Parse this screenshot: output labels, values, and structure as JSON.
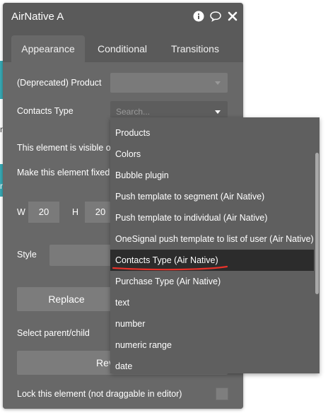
{
  "background": {
    "peek_chars": [
      "n",
      "r"
    ]
  },
  "panel": {
    "title": "AirNative A",
    "icons": [
      "info-icon",
      "comment-icon",
      "close-icon"
    ]
  },
  "tabs": [
    {
      "label": "Appearance",
      "active": true
    },
    {
      "label": "Conditional",
      "active": false
    },
    {
      "label": "Transitions",
      "active": false
    }
  ],
  "fields": {
    "product_label": "(Deprecated) Product",
    "contacts_type_label": "Contacts Type",
    "contacts_type_placeholder": "Search...",
    "visible_label": "This element is visible o",
    "fixed_label": "Make this element fixed",
    "w_label": "W",
    "w_value": "20",
    "h_label": "H",
    "h_value": "20",
    "style_label": "Style",
    "replace_label": "Replace",
    "select_parent_label": "Select parent/child",
    "reveal_label": "Reveal in th",
    "lock_label": "Lock this element (not draggable in editor)"
  },
  "dropdown": {
    "items": [
      "Products",
      "Colors",
      "Bubble plugin",
      "Push template to segment (Air Native)",
      "Push template to individual (Air Native)",
      "OneSignal push template to list of user (Air Native)",
      "Contacts Type (Air Native)",
      "Purchase Type (Air Native)",
      "text",
      "number",
      "numeric range",
      "date"
    ],
    "selected_index": 6,
    "highlight_color": "#e8322a"
  },
  "colors": {
    "panel_bg": "#5a5a5a",
    "body_bg": "#686868",
    "menu_bg": "#5f5f5f",
    "selected_bg": "#2c2c2c",
    "accent_teal": "#37a8b3"
  }
}
